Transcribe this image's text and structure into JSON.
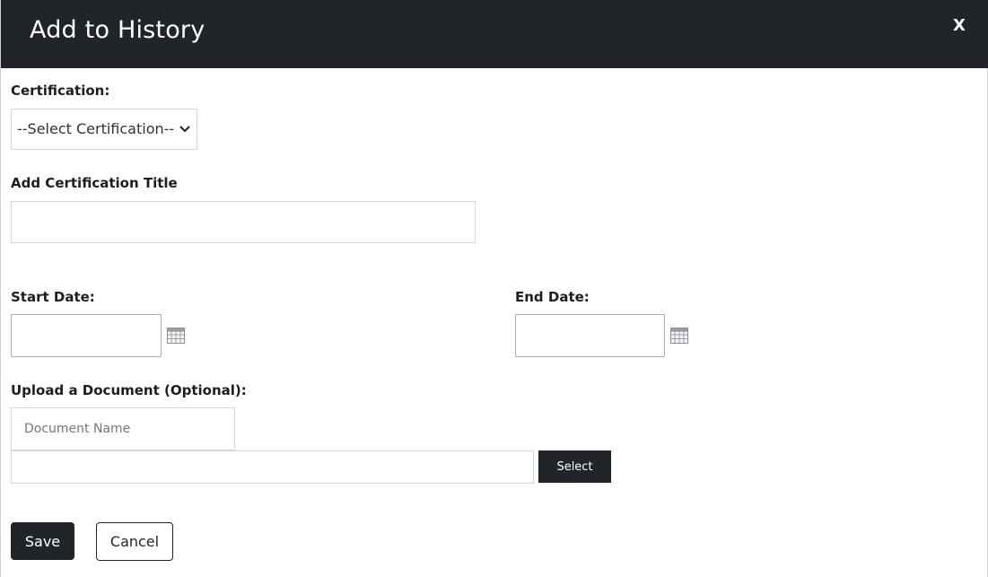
{
  "modal": {
    "title": "Add to History",
    "close_label": "X"
  },
  "form": {
    "certification_label": "Certification:",
    "certification_select_value": "--Select Certification--",
    "add_title_label": "Add Certification Title",
    "add_title_value": "",
    "start_date_label": "Start Date:",
    "start_date_value": "",
    "end_date_label": "End Date:",
    "end_date_value": "",
    "upload_label": "Upload a Document (Optional):",
    "document_name_placeholder": "Document Name",
    "file_path_value": "",
    "select_button": "Select"
  },
  "actions": {
    "save": "Save",
    "cancel": "Cancel"
  },
  "icons": {
    "calendar": "calendar-icon",
    "chevron": "chevron-down-icon"
  },
  "colors": {
    "header_bg": "#212529",
    "header_text": "#ffffff",
    "button_dark": "#212529"
  }
}
